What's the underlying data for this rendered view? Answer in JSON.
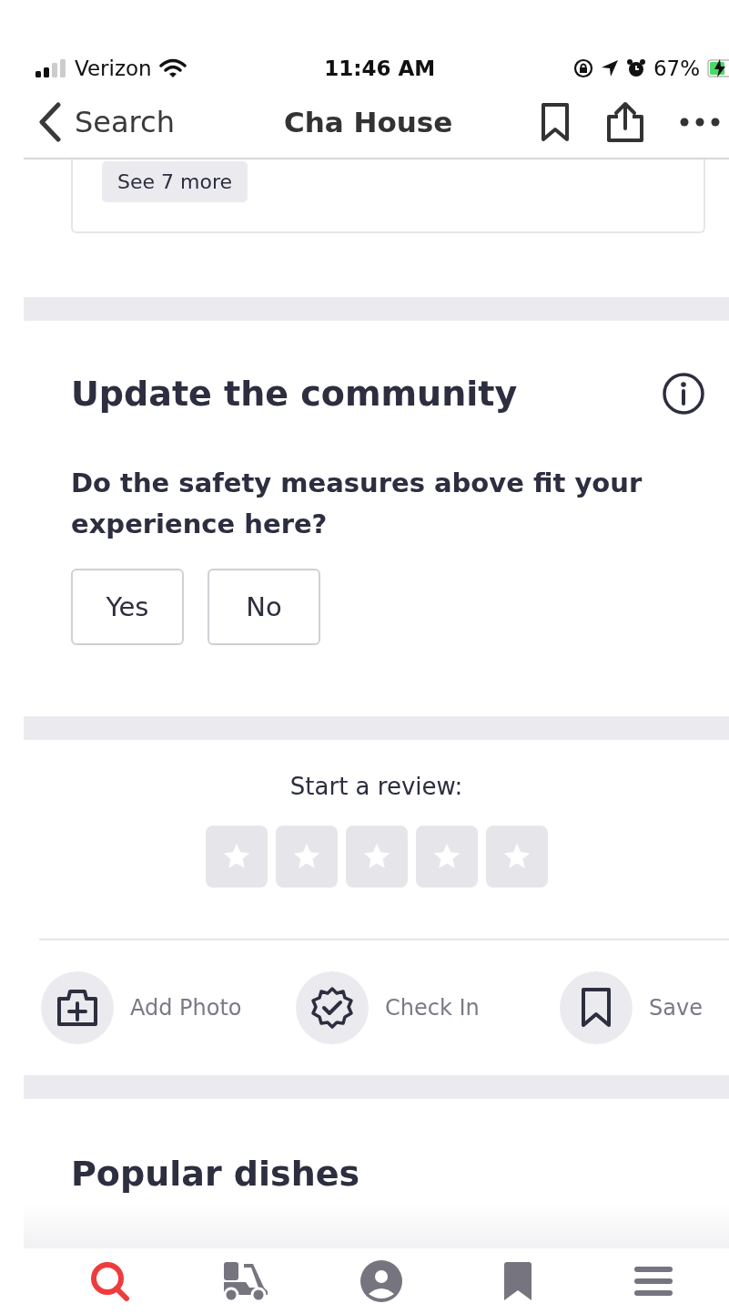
{
  "status_bar": {
    "carrier": "Verizon",
    "time": "11:46 AM",
    "battery": "67%"
  },
  "nav": {
    "back": "Search",
    "title": "Cha House"
  },
  "card": {
    "see_more": "See 7 more"
  },
  "community": {
    "title": "Update the community",
    "question": "Do the safety measures above fit your experience here?",
    "answers": [
      {
        "label": "Yes",
        "selected": false
      },
      {
        "label": "No",
        "selected": false
      }
    ]
  },
  "review": {
    "prompt": "Start a review:",
    "stars": 0
  },
  "actions": [
    {
      "kind": "photo",
      "label": "Add Photo"
    },
    {
      "kind": "checkin",
      "label": "Check In"
    },
    {
      "kind": "save",
      "label": "Save"
    }
  ],
  "popular": {
    "title": "Popular dishes"
  },
  "tab_bar": [
    {
      "kind": "search",
      "selected": true
    },
    {
      "kind": "delivery",
      "selected": false
    },
    {
      "kind": "profile",
      "selected": false
    },
    {
      "kind": "bookmarks",
      "selected": false
    },
    {
      "kind": "menu",
      "selected": false
    }
  ]
}
